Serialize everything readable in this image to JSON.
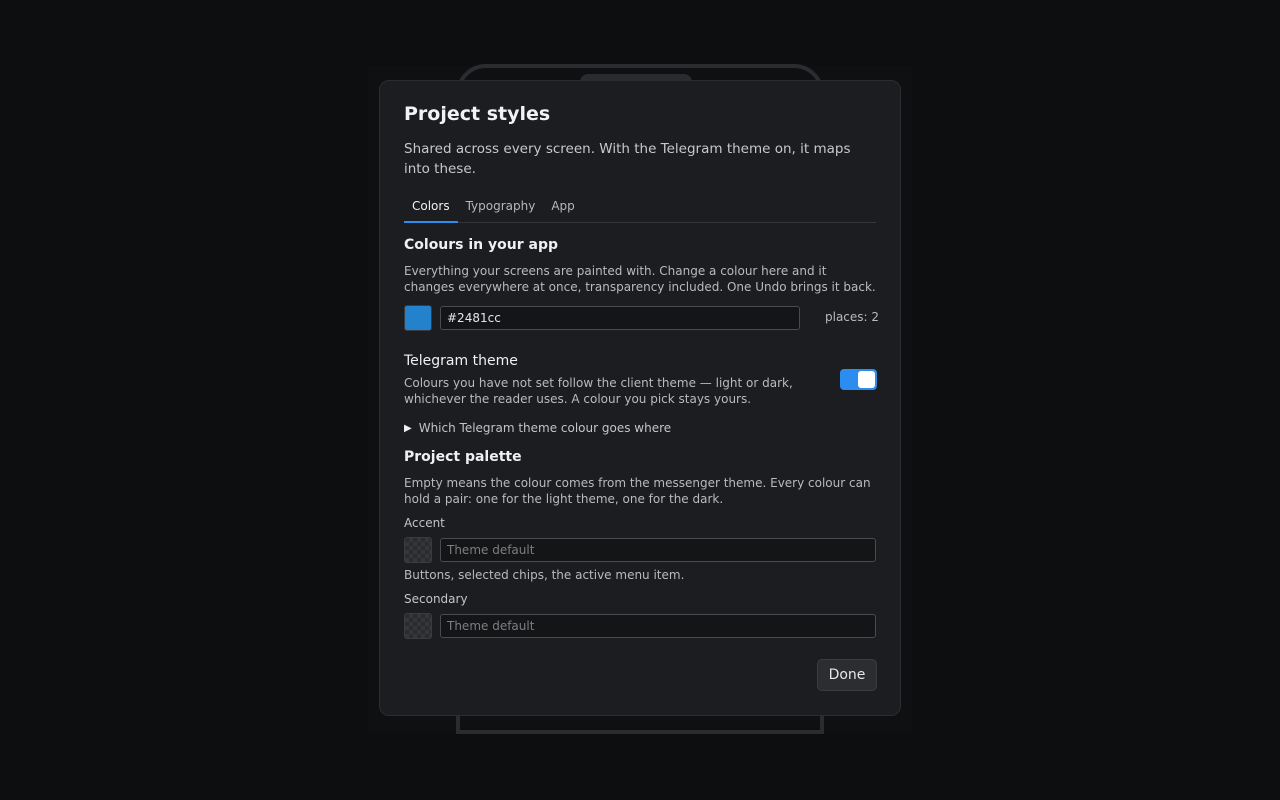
{
  "dialog": {
    "title": "Project styles",
    "subtitle": "Shared across every screen. With the Telegram theme on, it maps into these."
  },
  "tabs": [
    {
      "label": "Colors",
      "active": true
    },
    {
      "label": "Typography",
      "active": false
    },
    {
      "label": "App",
      "active": false
    }
  ],
  "colours_section": {
    "heading": "Colours in your app",
    "description": "Everything your screens are painted with. Change a colour here and it changes everywhere at once, transparency included. One Undo brings it back.",
    "swatch_color": "#2481cc",
    "value": "#2481cc",
    "places": "places: 2"
  },
  "telegram_theme": {
    "label": "Telegram theme",
    "description": "Colours you have not set follow the client theme — light or dark, whichever the reader uses. A colour you pick stays yours.",
    "enabled": true,
    "disclosure_label": "Which Telegram theme colour goes where"
  },
  "palette": {
    "heading": "Project palette",
    "description": "Empty means the colour comes from the messenger theme. Every colour can hold a pair: one for the light theme, one for the dark.",
    "accent": {
      "label": "Accent",
      "placeholder": "Theme default",
      "hint": "Buttons, selected chips, the active menu item."
    },
    "secondary": {
      "label": "Secondary",
      "placeholder": "Theme default"
    }
  },
  "footer": {
    "done_label": "Done"
  },
  "colors": {
    "accent": "#2d8cf0",
    "background": "#1c1d20"
  }
}
